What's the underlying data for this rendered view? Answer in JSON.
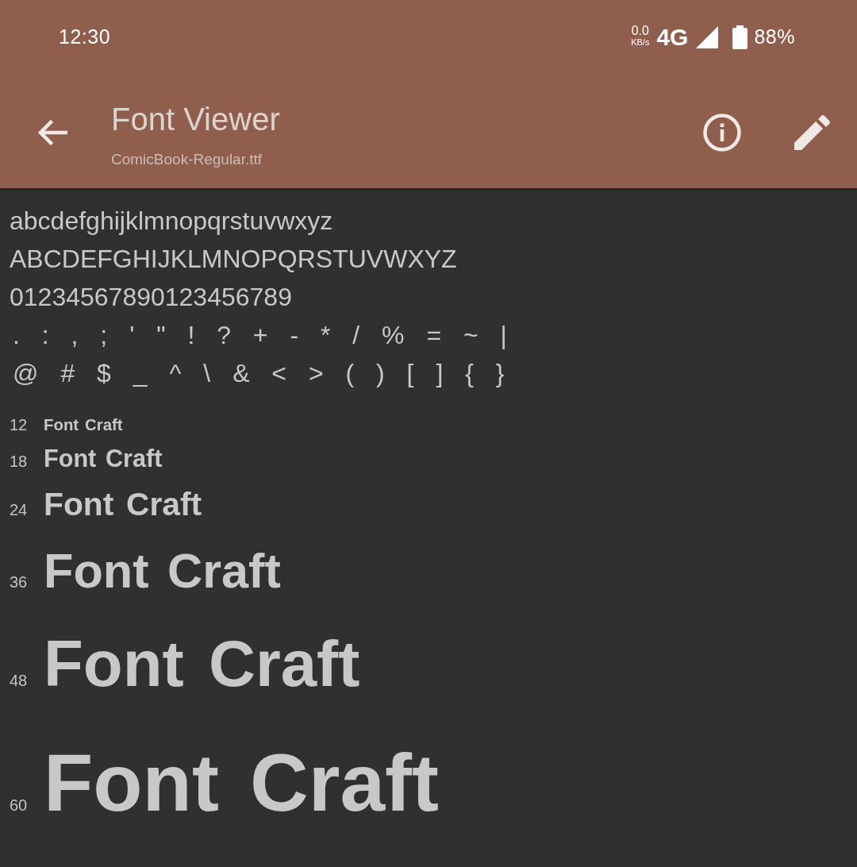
{
  "status_bar": {
    "time": "12:30",
    "net_speed": "0.0",
    "net_speed_unit": "KB/s",
    "network": "4G",
    "battery": "88%"
  },
  "toolbar": {
    "title": "Font Viewer",
    "subtitle": "ComicBook-Regular.ttf"
  },
  "glyph_lines": [
    "abcdefghijklmnopqrstuvwxyz",
    "ABCDEFGHIJKLMNOPQRSTUVWXYZ",
    "01234567890123456789",
    ". : , ; ' \" ! ? + - * / % = ~ |",
    "@ # $ _ ^ \\ & < > ( ) [ ] { }"
  ],
  "size_samples": [
    {
      "size": "12",
      "text": "Font Craft"
    },
    {
      "size": "18",
      "text": "Font Craft"
    },
    {
      "size": "24",
      "text": "Font Craft"
    },
    {
      "size": "36",
      "text": "Font Craft"
    },
    {
      "size": "48",
      "text": "Font Craft"
    },
    {
      "size": "60",
      "text": "Font Craft"
    }
  ]
}
